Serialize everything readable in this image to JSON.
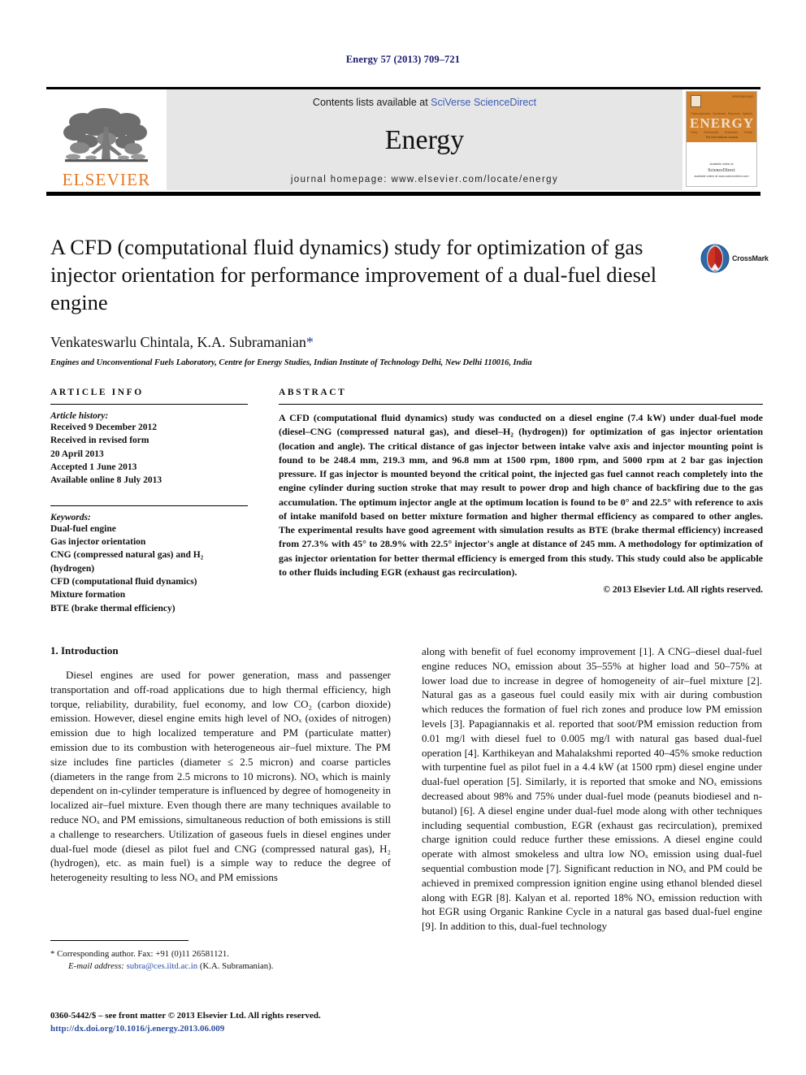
{
  "running_head": "Energy 57 (2013) 709–721",
  "masthead": {
    "publisher_logo_text": "ELSEVIER",
    "contents_prefix": "Contents lists available at ",
    "contents_link": "SciVerse ScienceDirect",
    "journal_name": "Energy",
    "homepage_line": "journal homepage: www.elsevier.com/locate/energy",
    "cover": {
      "issn": "ISSN 0360-5442",
      "title_letters": [
        "E",
        "N",
        "E",
        "R",
        "G",
        "Y"
      ],
      "subtitle": "The International Journal",
      "top_row_labels": [
        "Thermodynamics",
        "Conversion",
        "Resources",
        "Systems"
      ],
      "bottom_row_labels": [
        "Policy",
        "Environment",
        "Economics",
        "Society"
      ],
      "footer_brand": "ScienceDirect",
      "footer_tagline": "available online at www.sciencedirect.com",
      "footer_small": "Available online at"
    }
  },
  "article": {
    "title": "A CFD (computational fluid dynamics) study for optimization of gas injector orientation for performance improvement of a dual-fuel diesel engine",
    "authors": "Venkateswarlu Chintala, K.A. Subramanian",
    "corresponding_marker": "*",
    "affiliation": "Engines and Unconventional Fuels Laboratory, Centre for Energy Studies, Indian Institute of Technology Delhi, New Delhi 110016, India",
    "crossmark_label": "CrossMark"
  },
  "article_info": {
    "heading": "ARTICLE INFO",
    "history_label": "Article history:",
    "history_lines": [
      "Received 9 December 2012",
      "Received in revised form",
      "20 April 2013",
      "Accepted 1 June 2013",
      "Available online 8 July 2013"
    ],
    "keywords_label": "Keywords:",
    "keywords": [
      "Dual-fuel engine",
      "Gas injector orientation",
      "CNG (compressed natural gas) and H₂ (hydrogen)",
      "CFD (computational fluid dynamics)",
      "Mixture formation",
      "BTE (brake thermal efficiency)"
    ]
  },
  "abstract": {
    "heading": "ABSTRACT",
    "text": "A CFD (computational fluid dynamics) study was conducted on a diesel engine (7.4 kW) under dual-fuel mode (diesel–CNG (compressed natural gas), and diesel–H₂ (hydrogen)) for optimization of gas injector orientation (location and angle). The critical distance of gas injector between intake valve axis and injector mounting point is found to be 248.4 mm, 219.3 mm, and 96.8 mm at 1500 rpm, 1800 rpm, and 5000 rpm at 2 bar gas injection pressure. If gas injector is mounted beyond the critical point, the injected gas fuel cannot reach completely into the engine cylinder during suction stroke that may result to power drop and high chance of backfiring due to the gas accumulation. The optimum injector angle at the optimum location is found to be 0° and 22.5° with reference to axis of intake manifold based on better mixture formation and higher thermal efficiency as compared to other angles. The experimental results have good agreement with simulation results as BTE (brake thermal efficiency) increased from 27.3% with 45° to 28.9% with 22.5° injector's angle at distance of 245 mm. A methodology for optimization of gas injector orientation for better thermal efficiency is emerged from this study. This study could also be applicable to other fluids including EGR (exhaust gas recirculation).",
    "copyright": "© 2013 Elsevier Ltd. All rights reserved."
  },
  "introduction": {
    "heading": "1. Introduction",
    "left_paragraph": "Diesel engines are used for power generation, mass and passenger transportation and off-road applications due to high thermal efficiency, high torque, reliability, durability, fuel economy, and low CO₂ (carbon dioxide) emission. However, diesel engine emits high level of NOₓ (oxides of nitrogen) emission due to high localized temperature and PM (particulate matter) emission due to its combustion with heterogeneous air–fuel mixture. The PM size includes fine particles (diameter ≤ 2.5 micron) and coarse particles (diameters in the range from 2.5 microns to 10 microns). NOₓ which is mainly dependent on in-cylinder temperature is influenced by degree of homogeneity in localized air–fuel mixture. Even though there are many techniques available to reduce NOₓ and PM emissions, simultaneous reduction of both emissions is still a challenge to researchers. Utilization of gaseous fuels in diesel engines under dual-fuel mode (diesel as pilot fuel and CNG (compressed natural gas), H₂ (hydrogen), etc. as main fuel) is a simple way to reduce the degree of heterogeneity resulting to less NOₓ and PM emissions",
    "right_paragraph": "along with benefit of fuel economy improvement [1]. A CNG–diesel dual-fuel engine reduces NOₓ emission about 35–55% at higher load and 50–75% at lower load due to increase in degree of homogeneity of air–fuel mixture [2]. Natural gas as a gaseous fuel could easily mix with air during combustion which reduces the formation of fuel rich zones and produce low PM emission levels [3]. Papagiannakis et al. reported that soot/PM emission reduction from 0.01 mg/l with diesel fuel to 0.005 mg/l with natural gas based dual-fuel operation [4]. Karthikeyan and Mahalakshmi reported 40–45% smoke reduction with turpentine fuel as pilot fuel in a 4.4 kW (at 1500 rpm) diesel engine under dual-fuel operation [5]. Similarly, it is reported that smoke and NOₓ emissions decreased about 98% and 75% under dual-fuel mode (peanuts biodiesel and n-butanol) [6]. A diesel engine under dual-fuel mode along with other techniques including sequential combustion, EGR (exhaust gas recirculation), premixed charge ignition could reduce further these emissions. A diesel engine could operate with almost smokeless and ultra low NOₓ emission using dual-fuel sequential combustion mode [7]. Significant reduction in NOₓ and PM could be achieved in premixed compression ignition engine using ethanol blended diesel along with EGR [8]. Kalyan et al. reported 18% NOₓ emission reduction with hot EGR using Organic Rankine Cycle in a natural gas based dual-fuel engine [9]. In addition to this, dual-fuel technology"
  },
  "footnotes": {
    "corresponding": "* Corresponding author. Fax: +91 (0)11 26581121.",
    "email_label": "E-mail address:",
    "email": "subra@ces.iitd.ac.in",
    "email_suffix": "(K.A. Subramanian)."
  },
  "frontmatter": {
    "line1": "0360-5442/$ – see front matter © 2013 Elsevier Ltd. All rights reserved.",
    "doi": "http://dx.doi.org/10.1016/j.energy.2013.06.009"
  },
  "colors": {
    "link_blue": "#2b4ea2",
    "running_head_navy": "#1a1a6e",
    "elsevier_orange": "#e87722",
    "cover_orange": "#d2822c",
    "masthead_grey": "#e6e6e6"
  }
}
